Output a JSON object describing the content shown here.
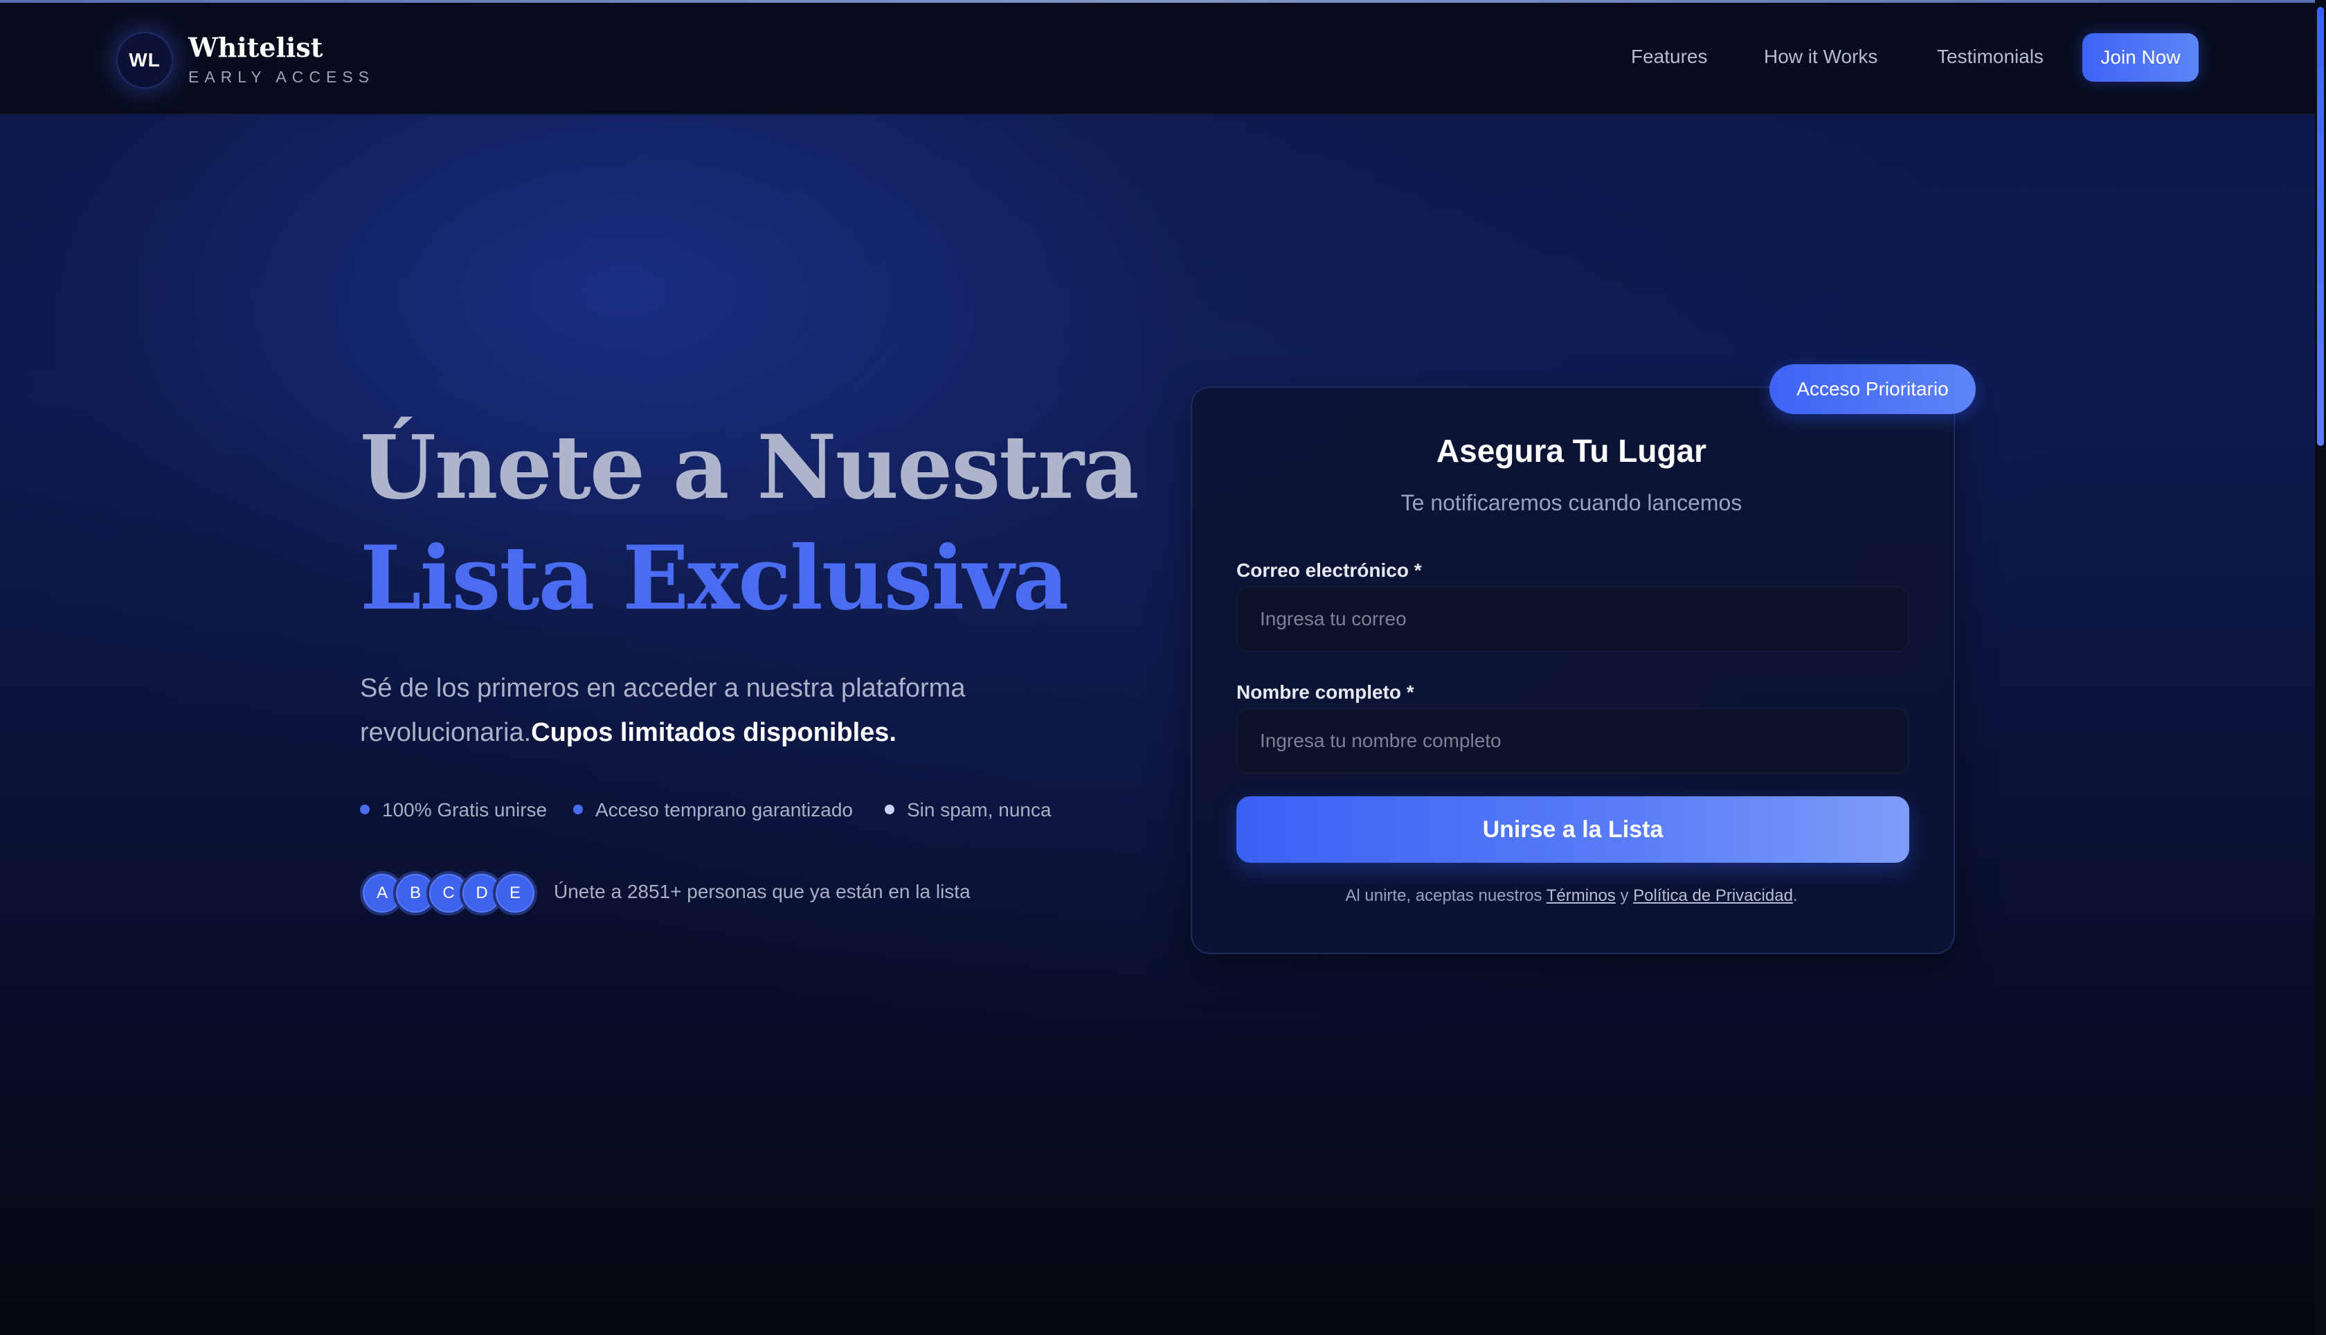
{
  "header": {
    "logo_initials": "WL",
    "brand_title": "Whitelist",
    "brand_subtitle": "EARLY ACCESS",
    "nav": [
      {
        "label": "Features"
      },
      {
        "label": "How it Works"
      },
      {
        "label": "Testimonials"
      }
    ],
    "cta_label": "Join Now"
  },
  "hero": {
    "title_line1": "Únete a Nuestra",
    "title_line2": "Lista Exclusiva",
    "description": "Sé de los primeros en acceder a nuestra plataforma revolucionaria.",
    "description_bold": "Cupos limitados disponibles.",
    "features": [
      {
        "label": "100% Gratis unirse"
      },
      {
        "label": "Acceso temprano garantizado"
      },
      {
        "label": "Sin spam, nunca"
      }
    ],
    "avatars": [
      "A",
      "B",
      "C",
      "D",
      "E"
    ],
    "social_proof": "Únete a 2851+ personas que ya están en la lista"
  },
  "form": {
    "badge": "Acceso Prioritario",
    "title": "Asegura Tu Lugar",
    "subtitle": "Te notificaremos cuando lancemos",
    "email_label": "Correo electrónico *",
    "email_placeholder": "Ingresa tu correo",
    "email_value": "",
    "name_label": "Nombre completo *",
    "name_placeholder": "Ingresa tu nombre completo",
    "name_value": "",
    "submit_label": "Unirse a la Lista",
    "terms_prefix": "Al unirte, aceptas nuestros ",
    "terms_link": "Términos",
    "terms_and": " y ",
    "privacy_link": "Política de Privacidad",
    "terms_suffix": "."
  },
  "colors": {
    "accent": "#4a6cf0",
    "background": "#0d1849",
    "header_bg": "#070b1c",
    "card_bg": "#0c1434"
  }
}
